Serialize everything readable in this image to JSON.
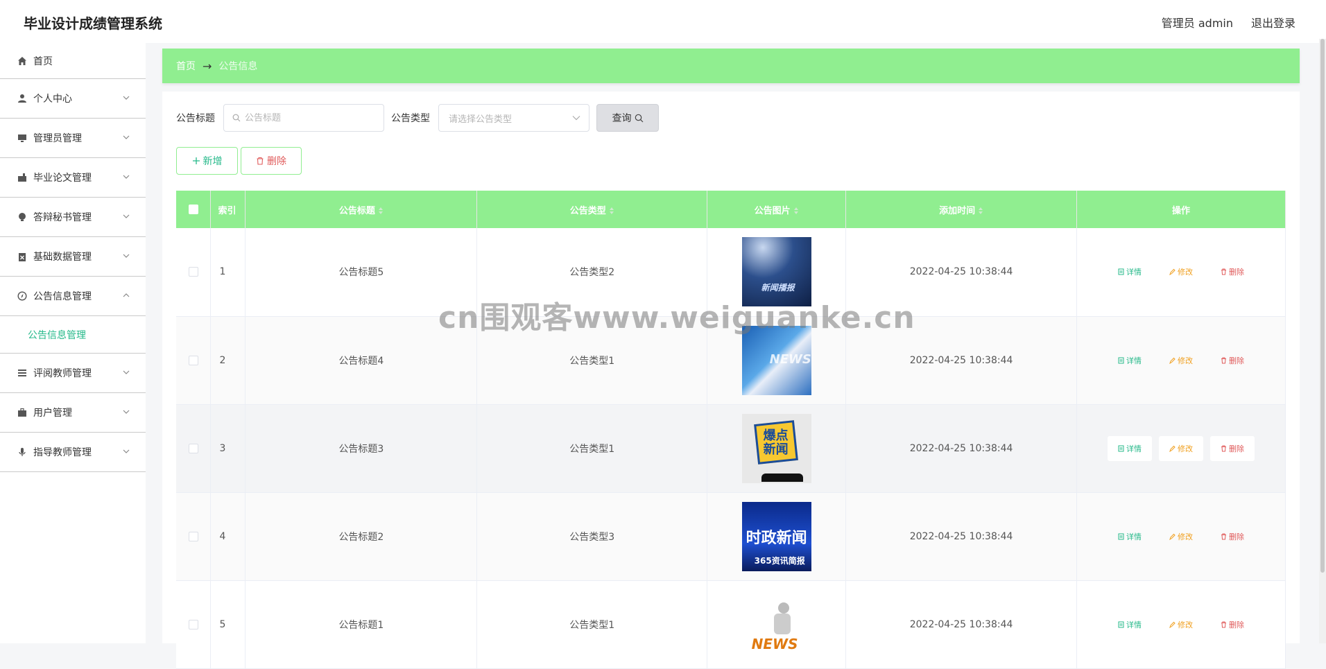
{
  "app": {
    "title": "毕业设计成绩管理系统",
    "user": "管理员 admin",
    "logout": "退出登录"
  },
  "sidebar": {
    "items": [
      {
        "label": "首页",
        "icon": "home-icon"
      },
      {
        "label": "个人中心",
        "icon": "user-icon"
      },
      {
        "label": "管理员管理",
        "icon": "monitor-icon"
      },
      {
        "label": "毕业论文管理",
        "icon": "toolbox-icon"
      },
      {
        "label": "答辩秘书管理",
        "icon": "bulb-icon"
      },
      {
        "label": "基础数据管理",
        "icon": "clipboard-icon"
      },
      {
        "label": "公告信息管理",
        "icon": "compass-icon"
      },
      {
        "label": "评阅教师管理",
        "icon": "list-icon"
      },
      {
        "label": "用户管理",
        "icon": "briefcase-icon"
      },
      {
        "label": "指导教师管理",
        "icon": "mic-icon"
      }
    ],
    "sub_item": "公告信息管理"
  },
  "breadcrumb": {
    "home": "首页",
    "separator": "→",
    "current": "公告信息"
  },
  "search": {
    "title_label": "公告标题",
    "title_placeholder": "公告标题",
    "type_label": "公告类型",
    "type_placeholder": "请选择公告类型",
    "query_label": "查询"
  },
  "actions": {
    "add_label": "新增",
    "delete_label": "删除"
  },
  "table": {
    "headers": {
      "index": "索引",
      "title": "公告标题",
      "type": "公告类型",
      "image": "公告图片",
      "time": "添加时间",
      "ops": "操作"
    },
    "op_labels": {
      "view": "详情",
      "edit": "修改",
      "delete": "删除"
    },
    "rows": [
      {
        "index": "1",
        "title": "公告标题5",
        "type": "公告类型2",
        "time": "2022-04-25 10:38:44",
        "image_text": "新闻播报"
      },
      {
        "index": "2",
        "title": "公告标题4",
        "type": "公告类型1",
        "time": "2022-04-25 10:38:44",
        "image_text": "NEWS"
      },
      {
        "index": "3",
        "title": "公告标题3",
        "type": "公告类型1",
        "time": "2022-04-25 10:38:44",
        "image_text": "爆点新闻"
      },
      {
        "index": "4",
        "title": "公告标题2",
        "type": "公告类型3",
        "time": "2022-04-25 10:38:44",
        "image_text": "时政新闻",
        "image_subtext": "365资讯简报"
      },
      {
        "index": "5",
        "title": "公告标题1",
        "type": "公告类型1",
        "time": "2022-04-25 10:38:44",
        "image_text": "NEWS"
      }
    ]
  },
  "watermark": "cn围观客www.weiguanke.cn",
  "colors": {
    "accent": "#90ee90",
    "link": "#26b98a",
    "danger": "#e05a5a",
    "warning": "#f0a020"
  }
}
